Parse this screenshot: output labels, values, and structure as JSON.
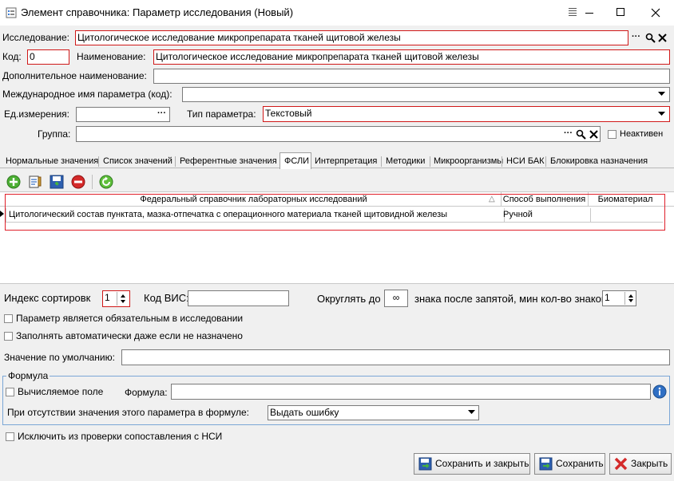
{
  "window": {
    "title": "Элемент справочника: Параметр исследования (Новый)",
    "menu_icon": "menu-grip-icon",
    "minimize_icon": "minimize-icon",
    "maximize_icon": "maximize-icon",
    "close_icon": "close-icon"
  },
  "form": {
    "study_label": "Исследование:",
    "study_value": "Цитологическое исследование микропрепарата тканей щитовой железы",
    "code_label": "Код:",
    "code_value": "0",
    "name_label": "Наименование:",
    "name_value": "Цитологическое исследование микропрепарата тканей щитовой железы",
    "additional_name_label": "Дополнительное наименование:",
    "additional_name_value": "",
    "international_name_label": "Международное имя параметра (код):",
    "international_name_value": "",
    "unit_label": "Ед.измерения:",
    "unit_value": "",
    "param_type_label": "Тип параметра:",
    "param_type_value": "Текстовый",
    "group_label": "Группа:",
    "group_value": "",
    "inactive_label": "Неактивен",
    "ellipsis": "···"
  },
  "tabs": [
    "Нормальные значения",
    "Список значений",
    "Референтные значения",
    "ФСЛИ",
    "Интерпретация",
    "Методики",
    "Микроорганизмы",
    "НСИ БАК",
    "Блокировка назначения"
  ],
  "active_tab_index": 3,
  "toolbar_icons": [
    "add-icon",
    "edit-document-icon",
    "save-icon",
    "delete-icon",
    "refresh-icon"
  ],
  "table": {
    "columns": [
      "Федеральный справочник лабораторных исследований",
      "Способ выполнения",
      "Биоматериал"
    ],
    "sort_indicator": "△",
    "rows": [
      [
        "Цитологический состав пунктата, мазка-отпечатка с операционного материала тканей щитовидной железы",
        "Ручной",
        ""
      ]
    ]
  },
  "bottom": {
    "sort_index_label": "Индекс сортировк",
    "sort_index_value": "1",
    "vis_code_label": "Код ВИС:",
    "vis_code_value": "",
    "round_label": "Округлять до",
    "round_value": "∞",
    "digits_label": "знака после запятой, мин кол-во знаков",
    "digits_value": "1",
    "mandatory_label": "Параметр является обязательным в исследовании",
    "autofill_label": "Заполнять автоматически даже если не назначено",
    "default_value_label": "Значение по умолчанию:",
    "default_value": "",
    "formula_group_label": "Формула",
    "computed_label": "Вычисляемое поле",
    "formula_label": "Формула:",
    "formula_value": "",
    "missing_value_label": "При отсутствии значения этого параметра в формуле:",
    "missing_value_option": "Выдать ошибку",
    "exclude_nsi_label": "Исключить из проверки сопоставления с НСИ"
  },
  "buttons": {
    "save_close": "Сохранить и закрыть",
    "save": "Сохранить",
    "close": "Закрыть"
  },
  "colors": {
    "required_border": "#d01818",
    "highlight_box": "#e0202a",
    "formula_group_border": "#7aa6d6"
  }
}
